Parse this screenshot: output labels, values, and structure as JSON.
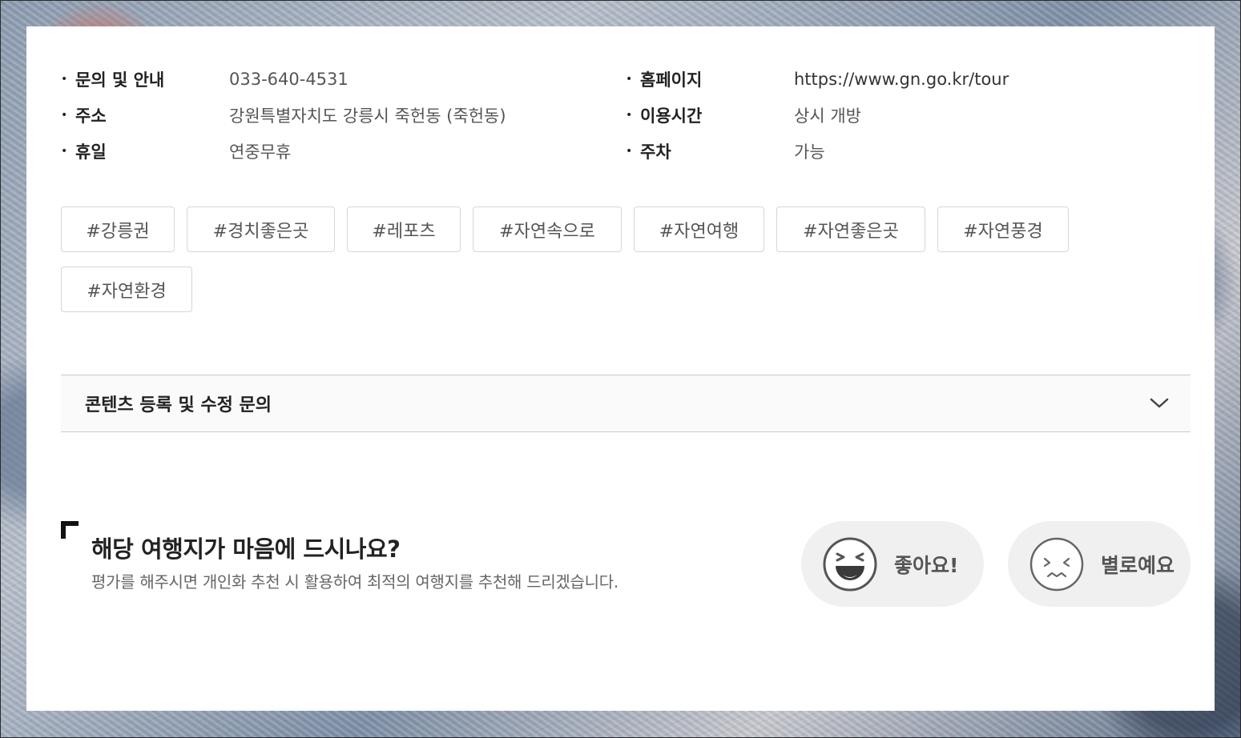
{
  "info": {
    "left": [
      {
        "label": "문의 및 안내",
        "value": "033-640-4531"
      },
      {
        "label": "주소",
        "value": "강원특별자치도 강릉시 죽헌동 (죽헌동)"
      },
      {
        "label": "휴일",
        "value": "연중무휴"
      }
    ],
    "right": [
      {
        "label": "홈페이지",
        "value": "https://www.gn.go.kr/tour"
      },
      {
        "label": "이용시간",
        "value": "상시 개방"
      },
      {
        "label": "주차",
        "value": "가능"
      }
    ]
  },
  "tags": [
    "#강릉권",
    "#경치좋은곳",
    "#레포츠",
    "#자연속으로",
    "#자연여행",
    "#자연좋은곳",
    "#자연풍경",
    "#자연환경"
  ],
  "accordion": {
    "title": "콘텐츠 등록 및 수정 문의",
    "icon": "chevron-down-icon"
  },
  "rating": {
    "title": "해당 여행지가 마음에 드시나요?",
    "description": "평가를 해주시면 개인화 추천 시 활용하여 최적의 여행지를 추천해 드리겠습니다.",
    "like_label": "좋아요!",
    "dislike_label": "별로예요",
    "like_icon": "laughing-face-icon",
    "dislike_icon": "unhappy-face-icon"
  }
}
